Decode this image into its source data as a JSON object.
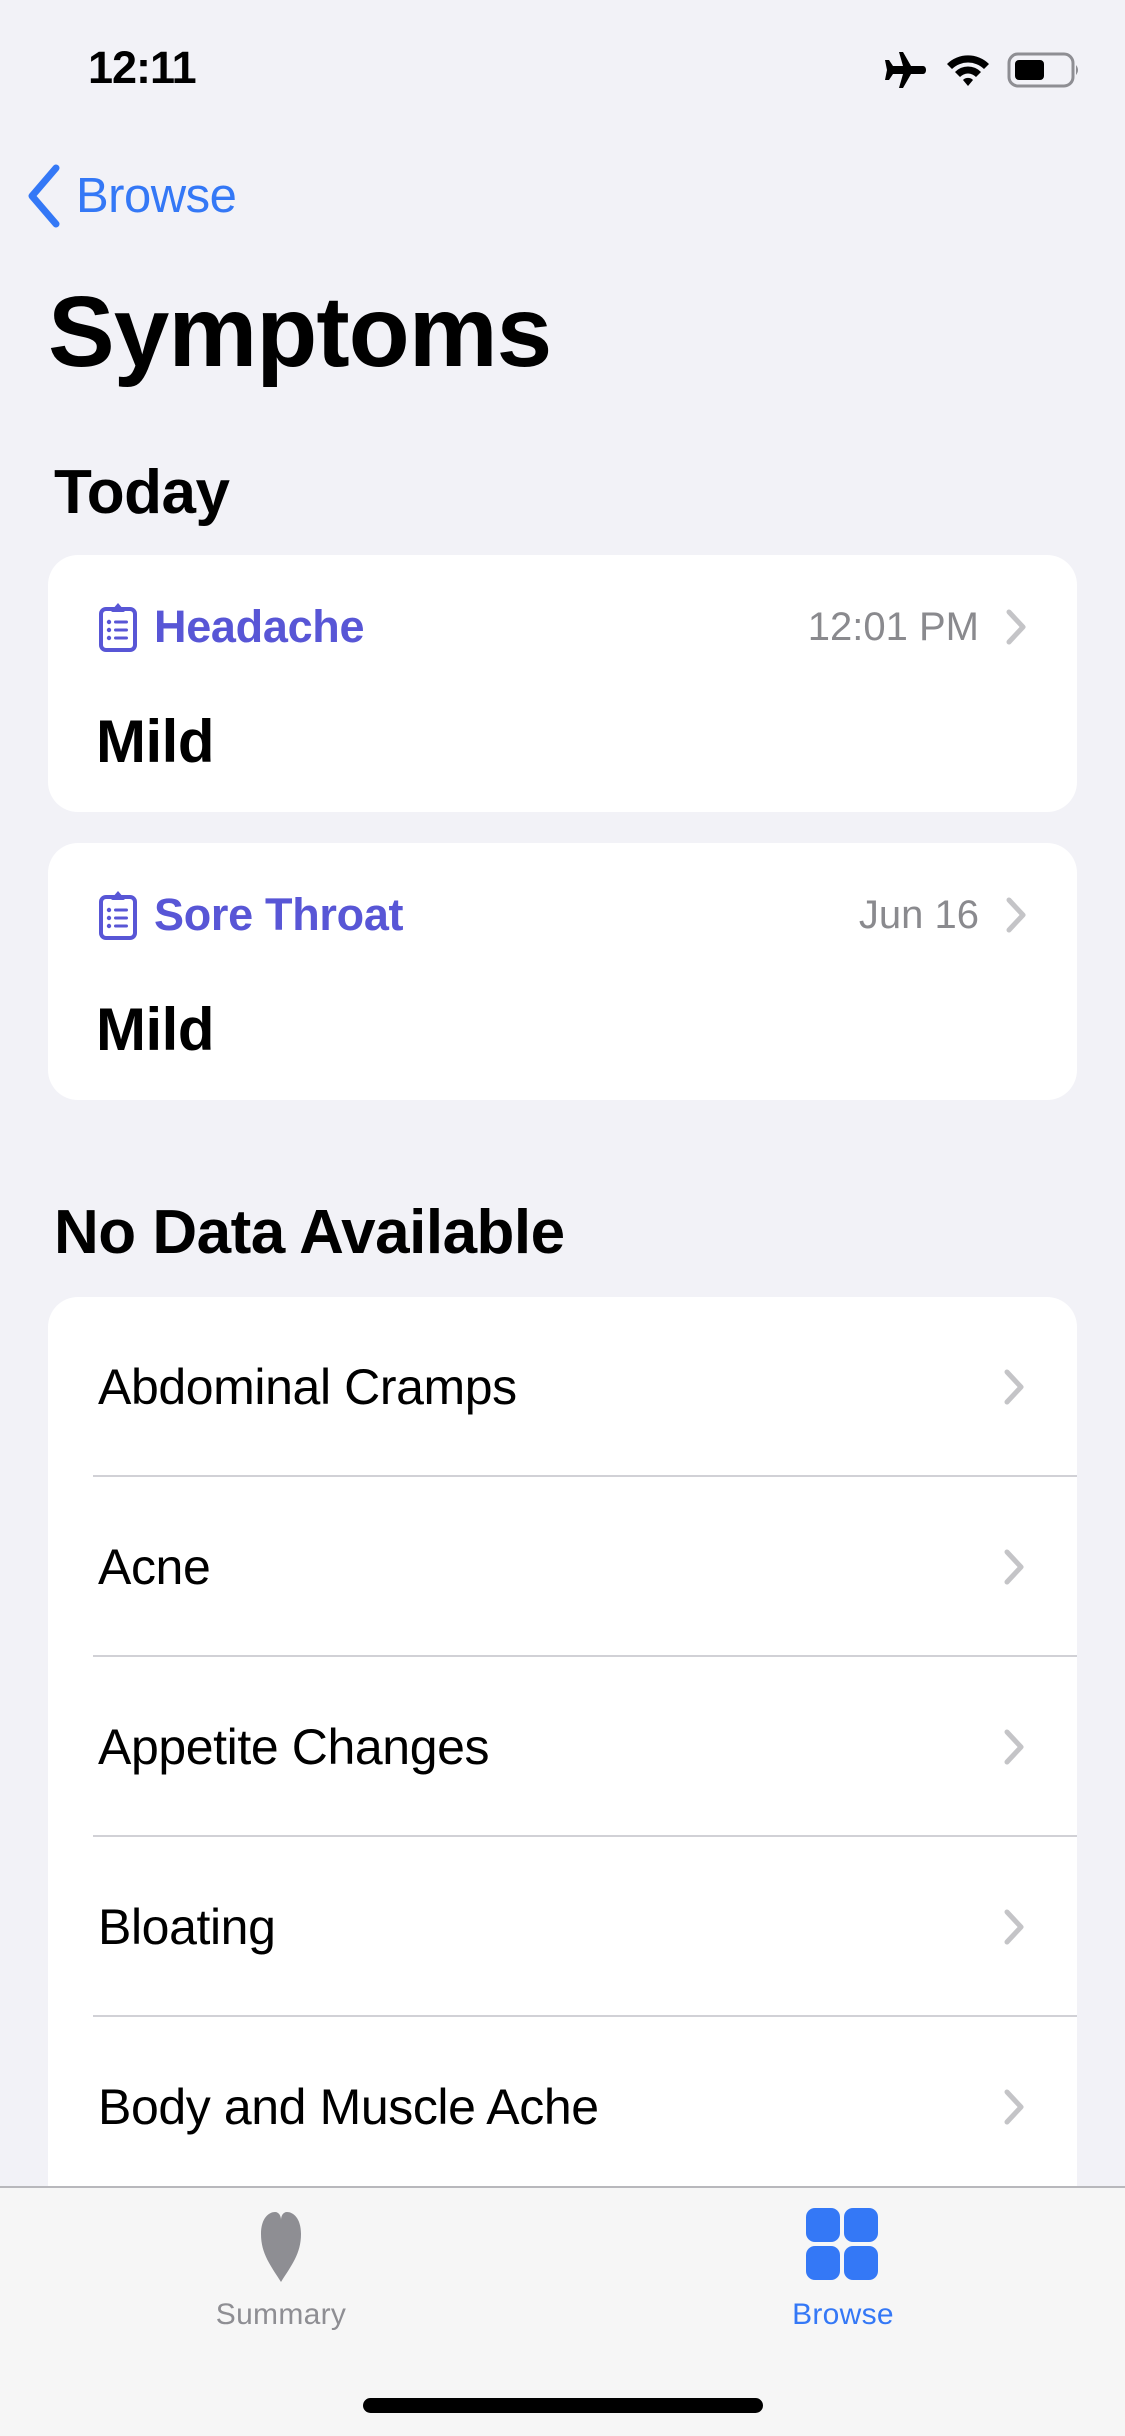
{
  "status_bar": {
    "time": "12:11",
    "icons": [
      "airplane-icon",
      "wifi-icon",
      "battery-icon"
    ],
    "battery_level_percent": 45
  },
  "nav": {
    "back_label": "Browse",
    "back_icon": "chevron-left-icon"
  },
  "page": {
    "title": "Symptoms"
  },
  "sections": {
    "today": {
      "header": "Today",
      "cards": [
        {
          "icon": "clipboard-list-icon",
          "title": "Headache",
          "meta": "12:01 PM",
          "value": "Mild"
        },
        {
          "icon": "clipboard-list-icon",
          "title": "Sore Throat",
          "meta": "Jun 16",
          "value": "Mild"
        }
      ]
    },
    "no_data": {
      "header": "No Data Available",
      "items": [
        {
          "label": "Abdominal Cramps"
        },
        {
          "label": "Acne"
        },
        {
          "label": "Appetite Changes"
        },
        {
          "label": "Bloating"
        },
        {
          "label": "Body and Muscle Ache"
        }
      ]
    }
  },
  "tab_bar": {
    "tabs": [
      {
        "label": "Summary",
        "icon": "heart-icon",
        "selected": false
      },
      {
        "label": "Browse",
        "icon": "grid-icon",
        "selected": true
      }
    ]
  },
  "colors": {
    "accent": "#3478f6",
    "symptom_title": "#5856d6",
    "background": "#f2f2f7",
    "secondary_text": "#8a8a8e",
    "chevron": "#c4c4c7"
  }
}
